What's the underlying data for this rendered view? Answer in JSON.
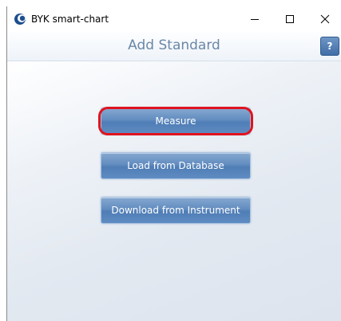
{
  "window": {
    "title": "BYK smart-chart",
    "controls": {
      "minimize_icon": "minimize-icon",
      "maximize_icon": "maximize-icon",
      "close_icon": "close-icon"
    }
  },
  "header": {
    "title": "Add Standard",
    "help_label": "?"
  },
  "actions": [
    {
      "label": "Measure",
      "highlighted": true
    },
    {
      "label": "Load from Database",
      "highlighted": false
    },
    {
      "label": "Download from Instrument",
      "highlighted": false
    }
  ],
  "colors": {
    "accent": "#4f7db5",
    "header_text": "#6a87a8",
    "highlight": "#e0131f"
  }
}
